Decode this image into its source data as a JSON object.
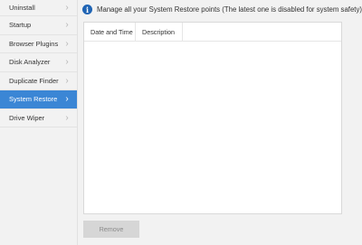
{
  "sidebar": {
    "items": [
      {
        "label": "Uninstall",
        "active": false
      },
      {
        "label": "Startup",
        "active": false
      },
      {
        "label": "Browser Plugins",
        "active": false
      },
      {
        "label": "Disk Analyzer",
        "active": false
      },
      {
        "label": "Duplicate Finder",
        "active": false
      },
      {
        "label": "System Restore",
        "active": true
      },
      {
        "label": "Drive Wiper",
        "active": false
      }
    ],
    "chevron_icon": "chevron-right-icon"
  },
  "info_bar": {
    "icon": "info-icon",
    "icon_glyph": "i",
    "text": "Manage all your System Restore points (The latest one is disabled for system safety)"
  },
  "table": {
    "columns": [
      "Date and Time",
      "Description"
    ],
    "rows": []
  },
  "actions": {
    "remove_label": "Remove"
  },
  "colors": {
    "accent": "#3b86d5",
    "info_icon": "#1f64b4",
    "sidebar_bg": "#f2f2f2"
  }
}
